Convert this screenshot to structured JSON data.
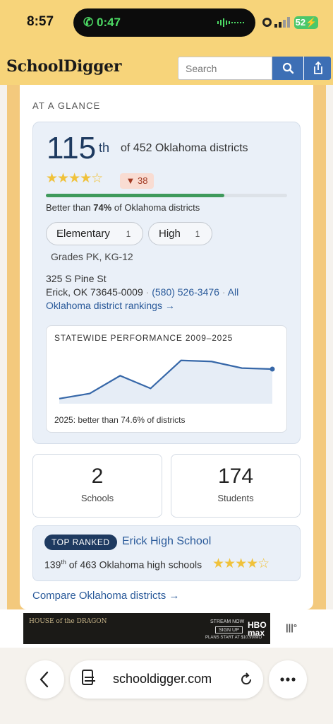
{
  "status_bar": {
    "time": "8:57",
    "call_time": "0:47",
    "battery": "52"
  },
  "header": {
    "logo": "SchoolDigger",
    "search_placeholder": "Search"
  },
  "glance": {
    "heading": "AT A GLANCE",
    "rank_number": "115",
    "rank_suffix": "th",
    "rank_of": "of 452 Oklahoma districts",
    "rating_stars": 3.5,
    "rating_text": "★★★★☆",
    "rank_change": "▼ 38",
    "percentile": 74,
    "better_prefix": "Better than ",
    "better_value": "74%",
    "better_suffix": " of Oklahoma districts",
    "levels": [
      {
        "label": "Elementary",
        "count": "1"
      },
      {
        "label": "High",
        "count": "1"
      }
    ],
    "grades": "Grades PK, KG-12",
    "address_line1": "325 S Pine St",
    "address_line2": "Erick, OK 73645-0009",
    "phone": "(580) 526-3476",
    "rankings_link_a": "All",
    "rankings_link_b": "Oklahoma district rankings →",
    "separator": "·"
  },
  "performance": {
    "title": "STATEWIDE PERFORMANCE 2009–2025",
    "caption": "2025: better than 74.6% of districts"
  },
  "chart_data": {
    "type": "area",
    "title": "STATEWIDE PERFORMANCE 2009–2025",
    "values": [
      0.1,
      0.2,
      0.55,
      0.3,
      0.85,
      0.83,
      0.7,
      0.68
    ],
    "caption": "2025: better than 74.6% of districts"
  },
  "stats": [
    {
      "number": "2",
      "label": "Schools"
    },
    {
      "number": "174",
      "label": "Students"
    }
  ],
  "top_ranked": {
    "badge": "TOP RANKED",
    "school": "Erick High School",
    "rank_num": "139",
    "rank_suffix": "th",
    "rank_of": " of 463 Oklahoma high schools",
    "stars_text": "★★★★☆"
  },
  "compare_link": "Compare Oklahoma districts →",
  "ad": {
    "title": "HOUSE of the DRAGON",
    "stream": "STREAM NOW",
    "signup": "SIGN UP",
    "brand": "HBO max",
    "price": "PLANS START AT $10.99/MO"
  },
  "browser": {
    "url": "schooldigger.com"
  },
  "colors": {
    "brand_yellow": "#f7d47a",
    "accent_blue": "#3d6fb5",
    "navy": "#1e3a60",
    "green": "#3f9a5c"
  }
}
